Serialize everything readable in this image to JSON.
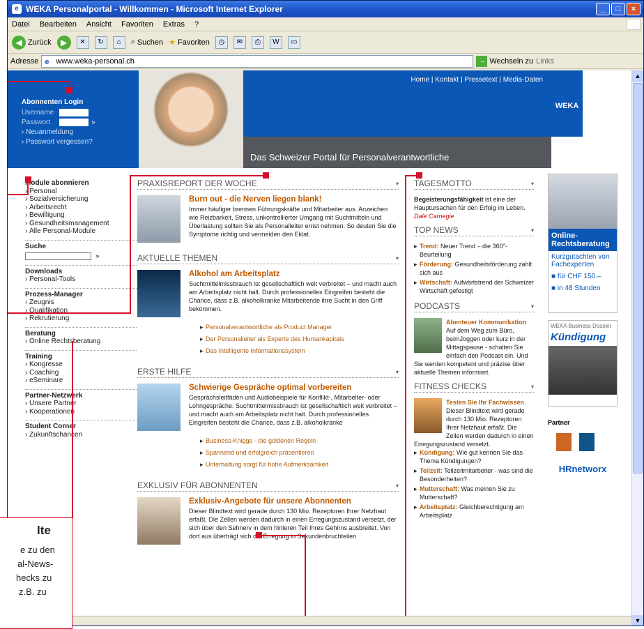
{
  "window": {
    "title": "WEKA Personalportal - Willkommen - Microsoft Internet Explorer"
  },
  "menu": [
    "Datei",
    "Bearbeiten",
    "Ansicht",
    "Favoriten",
    "Extras",
    "?"
  ],
  "toolbar": {
    "back": "Zurück",
    "search": "Suchen",
    "favorites": "Favoriten"
  },
  "address": {
    "label": "Adresse",
    "url": "www.weka-personal.ch",
    "go": "Wechseln zu",
    "links": "Links"
  },
  "header": {
    "nav": "Home | Kontakt | Presse­text | Media-Daten",
    "tagline": "Das Schweizer Portal für Personalverantwortliche",
    "logo": "WEKA"
  },
  "login": {
    "title": "Abonnenten Login",
    "user": "Username",
    "pass": "Passwort",
    "go": "»",
    "links": [
      "Neuanmeldung",
      "Passwort vergessen?"
    ]
  },
  "leftnav": {
    "module_title": "Module abonnieren",
    "module_items": [
      "Personal",
      "Sozialversicherung",
      "Arbeitsrecht",
      "Bewilligung",
      "Gesundheitsmanagement",
      "Alle Personal-Module"
    ],
    "search_title": "Suche",
    "search_go": "»",
    "downloads_title": "Downloads",
    "downloads_items": [
      "Personal-Tools"
    ],
    "prozess_title": "Prozess-Manager",
    "prozess_items": [
      "Zeugnis",
      "Qualifikation",
      "Rekrutierung"
    ],
    "beratung_title": "Beratung",
    "beratung_items": [
      "Online Rechtsberatung"
    ],
    "training_title": "Training",
    "training_items": [
      "Kongresse",
      "Coaching",
      "eSeminare"
    ],
    "partner_title": "Partner-Netzwerk",
    "partner_items": [
      "Unsere Partner",
      "Kooperationen"
    ],
    "student_title": "Student Corner",
    "student_items": [
      "Zukunftschancen"
    ]
  },
  "main": {
    "s1": {
      "head": "PRAXISREPORT DER WOCHE",
      "title": "Burn out - die Nerven liegen blank!",
      "text": "Immer häufiger brennen Führungskräfte und Mitarbeiter aus. Anzeichen wie Reizbarkeit, Stress, unkontrollierter Umgang mit Suchtmitteln und Überlastung sollten Sie als Personalleiter ernst nehmen. So deuten Sie die Symptome richtig und vermeiden den Eklat."
    },
    "s2": {
      "head": "AKTUELLE THEMEN",
      "title": "Alkohol am Arbeitsplatz",
      "text": "Suchtmittelmissbrauch ist gesellschaftlich weit verbreitet – und macht auch am Arbeitsplatz nicht halt. Durch professionelles Eingreifen besteht die Chance, dass z.B. alkoholkranke Mitarbeitende ihre Sucht in den Griff bekommen.",
      "links": [
        "Personalverantwortliche als Product Manager",
        "Der Personalleiter als Experte des Humankapitals",
        "Das Intelligente Informationssystem"
      ]
    },
    "s3": {
      "head": "ERSTE HILFE",
      "title": "Schwierige Gespräche optimal vorbereiten",
      "text": "Gesprächsleitfäden und Audiobeispiele für Konflikt-, Mitarbeiter- oder Lohngespräche. Suchtmittelmissbrauch ist gesellschaftlich weit verbreitet – und macht auch am Arbeitsplatz nicht halt. Durch professionelles Eingreifen besteht die Chance, dass z.B. alkoholkranke",
      "links": [
        "Business-Knigge - die goldenen Regeln",
        "Spannend und erfolgreich präsentieren",
        "Unterhaltung sorgt für hohe Aufmerksamkeit"
      ]
    },
    "s4": {
      "head": "EXKLUSIV FÜR ABONNENTEN",
      "title": "Exklusiv-Angebote für unsere Abonnenten",
      "text": "Dieser Blindtext wird gerade durch 130 Mio. Rezeptoren Ihrer Netzhaut erfaßt. Die Zellen werden dadurch in einen Erregungszustand versetzt, der sich über den Sehnerv in dem hinteren Teil Ihres Gehirns ausbreitet. Von dort aus überträgt sich die Erregung in Sekundenbruchteilen"
    }
  },
  "right": {
    "motto_head": "TAGESMOTTO",
    "motto_bold": "Begeisterungsfähigkeit",
    "motto_text": " ist eine der Hauptursachen für den Erfolg im Leben.",
    "motto_author": "Dale Carnegie",
    "news_head": "TOP NEWS",
    "news": [
      {
        "b": "Trend:",
        "t": " Neuer Trend – die 360°-Beurteilung"
      },
      {
        "b": "Förderung:",
        "t": " Gesundheitsförderung zahlt sich aus"
      },
      {
        "b": "Wirtschaft:",
        "t": " Aufwärtstrend der Schweizer Wirtschaft gefestigt"
      }
    ],
    "podcast_head": "PODCASTS",
    "podcast_title": "Abenteuer Kommunikation",
    "podcast_text": "Auf dem Weg zum Büro, beimJoggen oder kurz in der Mittagspause - schalten Sie einfach den Podcast ein. Und Sie werden kompetent und präzise über aktuelle Themen informiert.",
    "fitness_head": "FITNESS CHECKS",
    "fitness_title": "Testen Sie Ihr Fachwissen",
    "fitness_text": "Dieser Blindtext wird gerade durch 130 Mio. Rezeptoren Ihrer Netzhaut erfaßt. Die Zellen werden dadurch in einen Erregungszustand versetzt.",
    "checks": [
      {
        "b": "Kündigung:",
        "t": " Wie gut kennen Sie das Thema Kündigungen?"
      },
      {
        "b": "Teilzeit:",
        "t": " Teilzeitmitarbeiter - was sind die Besonderheiten?"
      },
      {
        "b": "Mutterschaft:",
        "t": " Was meinen Sie zu Mutterschaft?"
      },
      {
        "b": "Arbeitsplatz:",
        "t": " Gleichberechtigung am Arbeitsplatz"
      }
    ]
  },
  "ads": {
    "ad1_title": "Online-Rechtsberatung",
    "ad1_l1": "Kurzgutachten von Fachexperten",
    "ad1_l2": "■ für CHF 150.–",
    "ad1_l3": "■ in 48 Stunden",
    "ad2_head": "WEKA Business Dossier",
    "ad2_title": "Kündigung",
    "partner": "Partner",
    "hrnet": "HRnetworx"
  },
  "annotation": {
    "title": "lte",
    "lines": [
      "e zu den",
      "al-News-",
      "hecks zu",
      "z.B. zu"
    ]
  }
}
